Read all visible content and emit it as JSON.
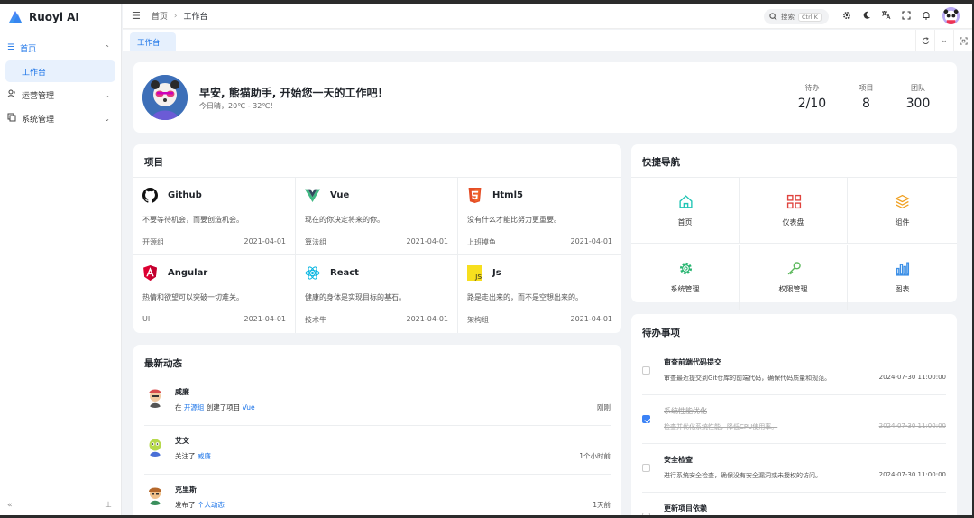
{
  "brand": {
    "name": "Ruoyi AI"
  },
  "sidebar": {
    "items": [
      {
        "label": "首页",
        "icon": "menu-icon"
      },
      {
        "label": "工作台"
      },
      {
        "label": "运营管理",
        "icon": "users-icon"
      },
      {
        "label": "系统管理",
        "icon": "copy-icon"
      }
    ]
  },
  "header": {
    "breadcrumb_home": "首页",
    "breadcrumb_sep": "›",
    "breadcrumb_current": "工作台",
    "search_placeholder": "搜索",
    "search_shortcut": "Ctrl K"
  },
  "tabs": {
    "active": "工作台"
  },
  "welcome": {
    "greeting": "早安, 熊猫助手, 开始您一天的工作吧！",
    "weather": "今日晴，20℃ - 32℃！",
    "stats": [
      {
        "label": "待办",
        "value": "2/10"
      },
      {
        "label": "项目",
        "value": "8"
      },
      {
        "label": "团队",
        "value": "300"
      }
    ]
  },
  "projects": {
    "title": "项目",
    "items": [
      {
        "name": "Github",
        "desc": "不要等待机会，而要创造机会。",
        "group": "开源组",
        "date": "2021-04-01",
        "icon": "github-icon"
      },
      {
        "name": "Vue",
        "desc": "现在的你决定将来的你。",
        "group": "算法组",
        "date": "2021-04-01",
        "icon": "vue-icon"
      },
      {
        "name": "Html5",
        "desc": "没有什么才能比努力更重要。",
        "group": "上班摸鱼",
        "date": "2021-04-01",
        "icon": "html5-icon"
      },
      {
        "name": "Angular",
        "desc": "热情和欲望可以突破一切难关。",
        "group": "UI",
        "date": "2021-04-01",
        "icon": "angular-icon"
      },
      {
        "name": "React",
        "desc": "健康的身体是实现目标的基石。",
        "group": "技术牛",
        "date": "2021-04-01",
        "icon": "react-icon"
      },
      {
        "name": "Js",
        "desc": "路是走出来的，而不是空想出来的。",
        "group": "架构组",
        "date": "2021-04-01",
        "icon": "js-icon"
      }
    ]
  },
  "quicknav": {
    "title": "快捷导航",
    "items": [
      {
        "label": "首页",
        "icon": "home-icon",
        "color": "#22c5b5"
      },
      {
        "label": "仪表盘",
        "icon": "dashboard-icon",
        "color": "#e0443e"
      },
      {
        "label": "组件",
        "icon": "layers-icon",
        "color": "#f0a020"
      },
      {
        "label": "系统管理",
        "icon": "gear-icon",
        "color": "#2bb673"
      },
      {
        "label": "权限管理",
        "icon": "key-icon",
        "color": "#5cb85c"
      },
      {
        "label": "图表",
        "icon": "bar-chart-icon",
        "color": "#3b8fe6"
      }
    ]
  },
  "activity": {
    "title": "最新动态",
    "items": [
      {
        "name": "威廉",
        "prefix": "在",
        "link1": "开源组",
        "middle": "创建了项目",
        "link2": "Vue",
        "time": "刚刚"
      },
      {
        "name": "艾文",
        "prefix": "关注了",
        "link1": "威廉",
        "middle": "",
        "link2": "",
        "time": "1个小时前"
      },
      {
        "name": "克里斯",
        "prefix": "发布了",
        "link1": "个人动态",
        "middle": "",
        "link2": "",
        "time": "1天前"
      }
    ]
  },
  "todo": {
    "title": "待办事项",
    "items": [
      {
        "title": "审查前端代码提交",
        "desc": "审查最近提交到Git仓库的前端代码，确保代码质量和规范。",
        "time": "2024-07-30 11:00:00",
        "done": false
      },
      {
        "title": "系统性能优化",
        "desc": "检查并优化系统性能，降低CPU使用率。",
        "time": "2024-07-30 11:00:00",
        "done": true
      },
      {
        "title": "安全检查",
        "desc": "进行系统安全检查，确保没有安全漏洞或未授权的访问。",
        "time": "2024-07-30 11:00:00",
        "done": false
      },
      {
        "title": "更新项目依赖",
        "desc": "",
        "time": "",
        "done": false
      }
    ]
  },
  "colors": {
    "accent": "#1a73e8",
    "active_bg": "#e8f1fd"
  }
}
